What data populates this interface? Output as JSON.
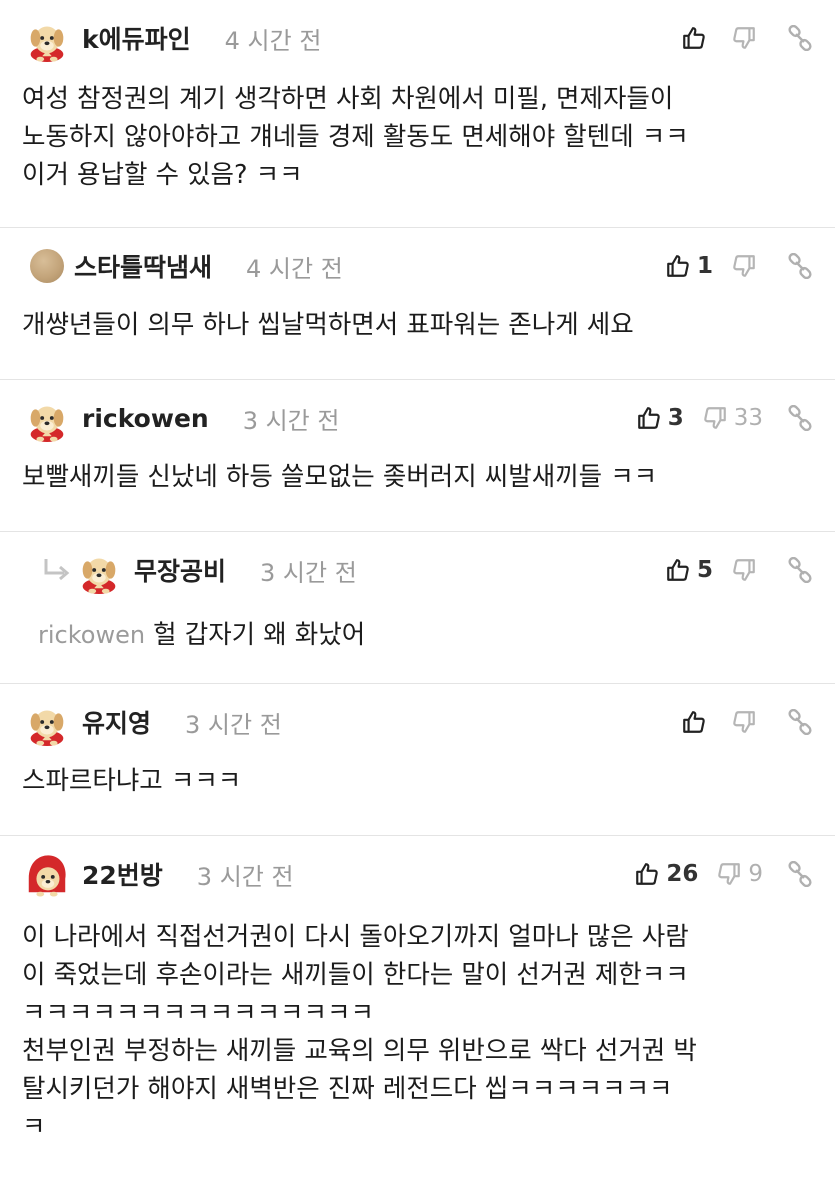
{
  "comments": [
    {
      "nick": "k에듀파인",
      "time": "4 시간 전",
      "up": "",
      "down": "",
      "body": "여성 참정권의 계기 생각하면 사회 차원에서 미필, 면제자들이\n노동하지 않아야하고 걔네들 경제 활동도 면세해야 할텐데 ㅋㅋ\n이거 용납할 수 있음? ㅋㅋ",
      "avatar": "dog-icon"
    },
    {
      "nick": "스타틀딱냄새",
      "time": "4 시간 전",
      "up": "1",
      "down": "",
      "body": "개썅년들이 의무 하나 씹날먹하면서 표파워는 존나게 세요",
      "avatar": "ball-avatar"
    },
    {
      "nick": "rickowen",
      "time": "3 시간 전",
      "up": "3",
      "down": "33",
      "body": "보빨새끼들 신났네 하등 쓸모없는 좆버러지 씨발새끼들 ㅋㅋ",
      "avatar": "dog-icon"
    },
    {
      "nick": "무장공비",
      "time": "3 시간 전",
      "up": "5",
      "down": "",
      "mention": "rickowen",
      "body": "헐 갑자기 왜 화났어",
      "avatar": "dog-icon"
    },
    {
      "nick": "유지영",
      "time": "3 시간 전",
      "up": "",
      "down": "",
      "body": "스파르타냐고 ㅋㅋㅋ",
      "avatar": "dog-icon"
    },
    {
      "nick": "22번방",
      "time": "3 시간 전",
      "up": "26",
      "down": "9",
      "body": "이 나라에서 직접선거권이 다시 돌아오기까지 얼마나 많은 사람\n이 죽었는데 후손이라는 새끼들이 한다는 말이 선거권 제한ㅋㅋ\nㅋㅋㅋㅋㅋㅋㅋㅋㅋㅋㅋㅋㅋㅋㅋ\n천부인권 부정하는 새끼들 교육의 의무 위반으로 싹다 선거권 박\n탈시키던가 해야지 새벽반은 진짜 레전드다 씹ㅋㅋㅋㅋㅋㅋㅋ\nㅋ",
      "avatar": "dog-hood-icon"
    }
  ]
}
